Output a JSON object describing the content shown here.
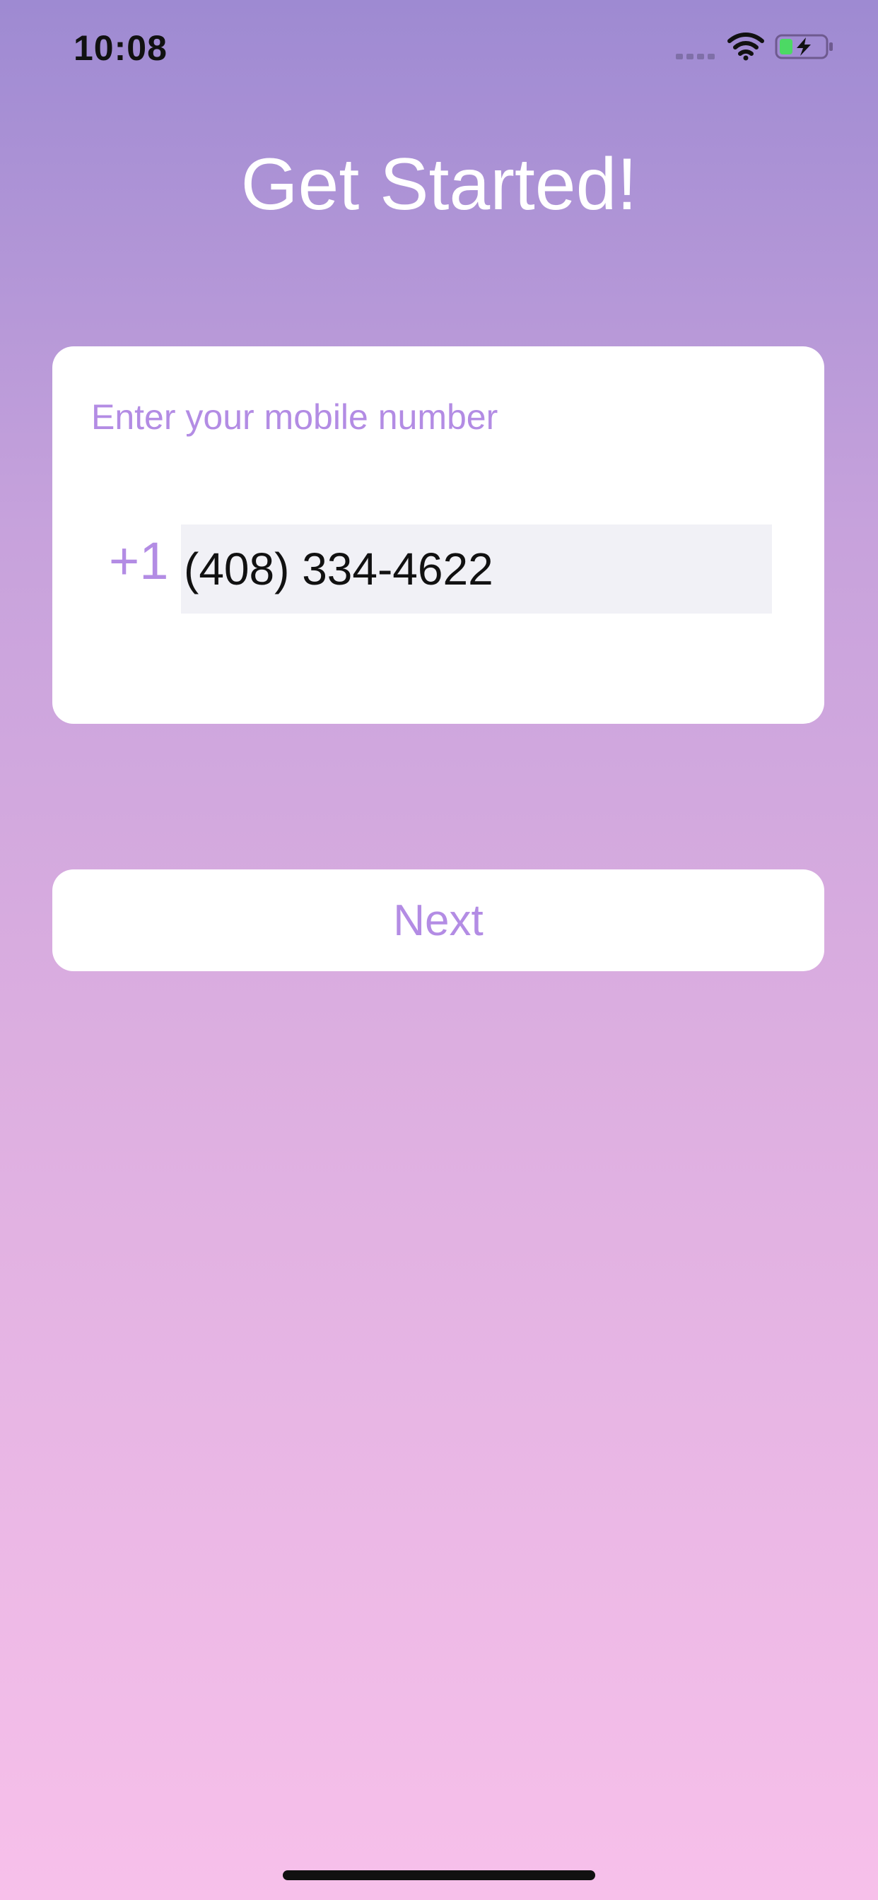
{
  "status_bar": {
    "time": "10:08",
    "icons": [
      "signal-icon",
      "wifi-icon",
      "battery-charging-icon"
    ],
    "battery_color": "#4cd964"
  },
  "title": "Get Started!",
  "phone_card": {
    "label": "Enter your mobile number",
    "country_code": "+1",
    "phone_value": "(408) 334-4622"
  },
  "next_button": {
    "label": "Next"
  },
  "colors": {
    "accent": "#b38ce4",
    "card_background": "#ffffff",
    "input_background": "#f1f1f6",
    "gradient_top": "#9e8ad2",
    "gradient_bottom": "#f7c0ea"
  }
}
